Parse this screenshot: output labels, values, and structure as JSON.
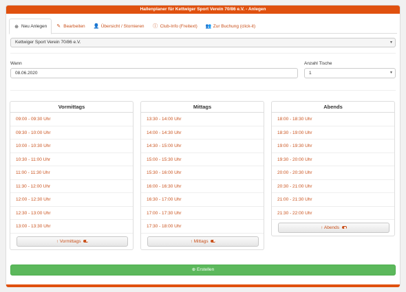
{
  "header": {
    "title": "Hallenplaner für Kettwiger Sport Verein 70/86 e.V. - Anlegen"
  },
  "tabs": [
    {
      "label": "Neu Anlegen",
      "icon": "plus-circle-icon"
    },
    {
      "label": "Bearbeiten",
      "icon": "edit-icon"
    },
    {
      "label": "Übersicht / Stornieren",
      "icon": "user-minus-icon"
    },
    {
      "label": "Club-Info (Freitext)",
      "icon": "info-icon"
    },
    {
      "label": "Zur Buchung (click-it)",
      "icon": "users-icon"
    }
  ],
  "form": {
    "club_value": "Kettwiger Sport Verein 70/86 e.V.",
    "wann_label": "Wann",
    "wann_value": "08.06.2020",
    "tische_label": "Anzahl Tische",
    "tische_value": "1",
    "submit_label": "Erstellen"
  },
  "panels": {
    "vormittags": {
      "title": "Vormittags",
      "button": "Vormittags",
      "slots": [
        "09:00 - 09:30 Uhr",
        "09:30 - 10:00 Uhr",
        "10:00 - 10:30 Uhr",
        "10:30 - 11:00 Uhr",
        "11:00 - 11:30 Uhr",
        "11:30 - 12:00 Uhr",
        "12:00 - 12:30 Uhr",
        "12:30 - 13:00 Uhr",
        "13:00 - 13:30 Uhr"
      ]
    },
    "mittags": {
      "title": "Mittags",
      "button": "Mittags",
      "slots": [
        "13:30 - 14:00 Uhr",
        "14:00 - 14:30 Uhr",
        "14:30 - 15:00 Uhr",
        "15:00 - 15:30 Uhr",
        "15:30 - 16:00 Uhr",
        "16:00 - 16:30 Uhr",
        "16:30 - 17:00 Uhr",
        "17:00 - 17:30 Uhr",
        "17:30 - 18:00 Uhr"
      ]
    },
    "abends": {
      "title": "Abends",
      "button": "Abends",
      "slots": [
        "18:00 - 18:30 Uhr",
        "18:30 - 19:00 Uhr",
        "19:00 - 19:30 Uhr",
        "19:30 - 20:00 Uhr",
        "20:00 - 20:30 Uhr",
        "20:30 - 21:00 Uhr",
        "21:00 - 21:30 Uhr",
        "21:30 - 22:00 Uhr"
      ]
    }
  },
  "colors": {
    "accent": "#e0510f",
    "link": "#c9501a",
    "success": "#5cb85c"
  }
}
